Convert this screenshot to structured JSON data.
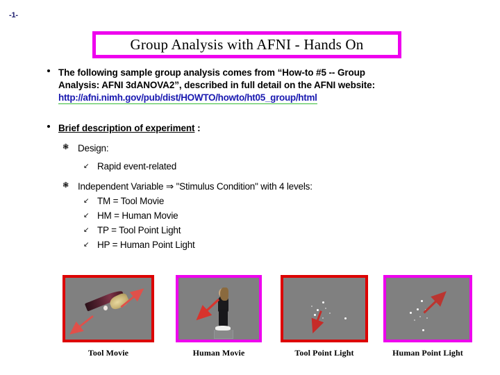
{
  "slide": {
    "number": "-1-",
    "title": "Group Analysis with AFNI - Hands On",
    "title_border_color": "#ee00ee"
  },
  "bullets": {
    "b1": {
      "line1": "The following sample group analysis comes from “How-to #5 -- Group",
      "line2": "Analysis: AFNI 3dANOVA2”, described in full detail on the AFNI website:",
      "url": "http://afni.nimh.gov/pub/dist/HOWTO/howto/ht05_group/html",
      "url_color": "#1a1ab0",
      "url_underline_color": "#33bb33"
    },
    "b2": {
      "heading": "Brief description of experiment",
      "heading_suffix": " :",
      "design_label": "Design:",
      "design_item": "Rapid event-related",
      "iv_label": "Independent Variable ⇒ \"Stimulus Condition\" with 4 levels:",
      "levels": [
        "TM = Tool Movie",
        "HM = Human Movie",
        "TP = Tool Point Light",
        "HP = Human Point Light"
      ]
    }
  },
  "bullet_glyphs": {
    "level1": "•",
    "level2": "❃",
    "level3": "↙"
  },
  "figures": [
    {
      "caption": "Tool Movie",
      "border_color": "#dd0000",
      "kind": "tool-movie",
      "arrow_color": "#e0504a"
    },
    {
      "caption": "Human Movie",
      "border_color": "#ee00ee",
      "kind": "human-movie",
      "arrow_color": "#d8332c"
    },
    {
      "caption": "Tool Point Light",
      "border_color": "#dd0000",
      "kind": "tool-point-light",
      "arrow_color": "#c62b28"
    },
    {
      "caption": "Human Point Light",
      "border_color": "#ee00ee",
      "kind": "human-point-light",
      "arrow_color": "#bb3530"
    }
  ]
}
